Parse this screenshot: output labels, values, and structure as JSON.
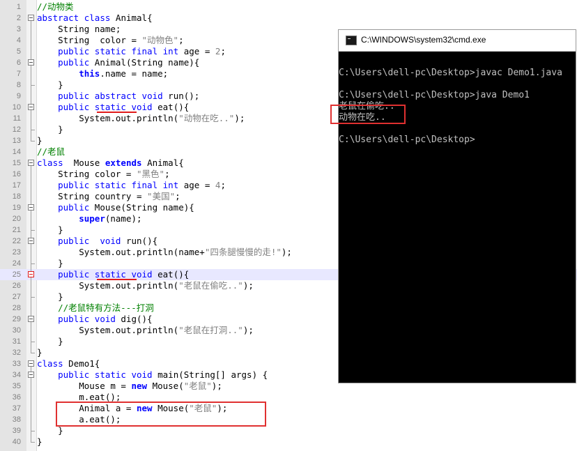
{
  "editor": {
    "lines": [
      {
        "n": "1",
        "tokens": [
          [
            "c",
            "//动物类"
          ]
        ]
      },
      {
        "n": "2",
        "tokens": [
          [
            "k",
            "abstract"
          ],
          [
            "p",
            " "
          ],
          [
            "k",
            "class"
          ],
          [
            "p",
            " Animal{"
          ]
        ]
      },
      {
        "n": "3",
        "tokens": [
          [
            "p",
            "    String name;"
          ]
        ]
      },
      {
        "n": "4",
        "tokens": [
          [
            "p",
            "    String  color = "
          ],
          [
            "s",
            "\"动物色\""
          ],
          [
            "p",
            ";"
          ]
        ]
      },
      {
        "n": "5",
        "tokens": [
          [
            "k",
            "    public"
          ],
          [
            "p",
            " "
          ],
          [
            "k",
            "static"
          ],
          [
            "p",
            " "
          ],
          [
            "k",
            "final"
          ],
          [
            "p",
            " "
          ],
          [
            "k",
            "int"
          ],
          [
            "p",
            " age = "
          ],
          [
            "s",
            "2"
          ],
          [
            "p",
            ";"
          ]
        ]
      },
      {
        "n": "6",
        "tokens": [
          [
            "k",
            "    public"
          ],
          [
            "p",
            " Animal(String name){"
          ]
        ]
      },
      {
        "n": "7",
        "tokens": [
          [
            "p",
            "        "
          ],
          [
            "b",
            "this"
          ],
          [
            "p",
            ".name = name;"
          ]
        ]
      },
      {
        "n": "8",
        "tokens": [
          [
            "p",
            "    }"
          ]
        ]
      },
      {
        "n": "9",
        "tokens": [
          [
            "k",
            "    public"
          ],
          [
            "p",
            " "
          ],
          [
            "k",
            "abstract"
          ],
          [
            "p",
            " "
          ],
          [
            "k",
            "void"
          ],
          [
            "p",
            " run();"
          ]
        ]
      },
      {
        "n": "10",
        "tokens": [
          [
            "k",
            "    public"
          ],
          [
            "p",
            " "
          ],
          [
            "k",
            "static"
          ],
          [
            "p",
            " "
          ],
          [
            "k",
            "void"
          ],
          [
            "p",
            " eat(){"
          ]
        ]
      },
      {
        "n": "11",
        "tokens": [
          [
            "p",
            "        System.out.println("
          ],
          [
            "s",
            "\"动物在吃..\""
          ],
          [
            "p",
            ");"
          ]
        ]
      },
      {
        "n": "12",
        "tokens": [
          [
            "p",
            "    }"
          ]
        ]
      },
      {
        "n": "13",
        "tokens": [
          [
            "p",
            "}"
          ]
        ]
      },
      {
        "n": "14",
        "tokens": [
          [
            "c",
            "//老鼠"
          ]
        ]
      },
      {
        "n": "15",
        "tokens": [
          [
            "k",
            "class"
          ],
          [
            "p",
            "  Mouse "
          ],
          [
            "b",
            "extends"
          ],
          [
            "p",
            " Animal{"
          ]
        ]
      },
      {
        "n": "16",
        "tokens": [
          [
            "p",
            "    String color = "
          ],
          [
            "s",
            "\"黑色\""
          ],
          [
            "p",
            ";"
          ]
        ]
      },
      {
        "n": "17",
        "tokens": [
          [
            "k",
            "    public"
          ],
          [
            "p",
            " "
          ],
          [
            "k",
            "static"
          ],
          [
            "p",
            " "
          ],
          [
            "k",
            "final"
          ],
          [
            "p",
            " "
          ],
          [
            "k",
            "int"
          ],
          [
            "p",
            " age = "
          ],
          [
            "s",
            "4"
          ],
          [
            "p",
            ";"
          ]
        ]
      },
      {
        "n": "18",
        "tokens": [
          [
            "p",
            "    String country = "
          ],
          [
            "s",
            "\"美国\""
          ],
          [
            "p",
            ";"
          ]
        ]
      },
      {
        "n": "19",
        "tokens": [
          [
            "k",
            "    public"
          ],
          [
            "p",
            " Mouse(String name){"
          ]
        ]
      },
      {
        "n": "20",
        "tokens": [
          [
            "p",
            "        "
          ],
          [
            "b",
            "super"
          ],
          [
            "p",
            "(name);"
          ]
        ]
      },
      {
        "n": "21",
        "tokens": [
          [
            "p",
            "    }"
          ]
        ]
      },
      {
        "n": "22",
        "tokens": [
          [
            "k",
            "    public"
          ],
          [
            "p",
            "  "
          ],
          [
            "k",
            "void"
          ],
          [
            "p",
            " run(){"
          ]
        ]
      },
      {
        "n": "23",
        "tokens": [
          [
            "p",
            "        System.out.println(name+"
          ],
          [
            "s",
            "\"四条腿慢慢的走!\""
          ],
          [
            "p",
            ");"
          ]
        ]
      },
      {
        "n": "24",
        "tokens": [
          [
            "p",
            "    }"
          ]
        ]
      },
      {
        "n": "25",
        "tokens": [
          [
            "k",
            "    public"
          ],
          [
            "p",
            " "
          ],
          [
            "k",
            "static"
          ],
          [
            "p",
            " "
          ],
          [
            "k",
            "void"
          ],
          [
            "p",
            " eat(){"
          ]
        ]
      },
      {
        "n": "26",
        "tokens": [
          [
            "p",
            "        System.out.println("
          ],
          [
            "s",
            "\"老鼠在偷吃..\""
          ],
          [
            "p",
            ");"
          ]
        ]
      },
      {
        "n": "27",
        "tokens": [
          [
            "p",
            "    }"
          ]
        ]
      },
      {
        "n": "28",
        "tokens": [
          [
            "c",
            "    //老鼠特有方法---打洞"
          ]
        ]
      },
      {
        "n": "29",
        "tokens": [
          [
            "k",
            "    public"
          ],
          [
            "p",
            " "
          ],
          [
            "k",
            "void"
          ],
          [
            "p",
            " dig(){"
          ]
        ]
      },
      {
        "n": "30",
        "tokens": [
          [
            "p",
            "        System.out.println("
          ],
          [
            "s",
            "\"老鼠在打洞..\""
          ],
          [
            "p",
            ");"
          ]
        ]
      },
      {
        "n": "31",
        "tokens": [
          [
            "p",
            "    }"
          ]
        ]
      },
      {
        "n": "32",
        "tokens": [
          [
            "p",
            "}"
          ]
        ]
      },
      {
        "n": "33",
        "tokens": [
          [
            "k",
            "class"
          ],
          [
            "p",
            " Demo1{"
          ]
        ]
      },
      {
        "n": "34",
        "tokens": [
          [
            "k",
            "    public"
          ],
          [
            "p",
            " "
          ],
          [
            "k",
            "static"
          ],
          [
            "p",
            " "
          ],
          [
            "k",
            "void"
          ],
          [
            "p",
            " main(String[] args) {"
          ]
        ]
      },
      {
        "n": "35",
        "tokens": [
          [
            "p",
            "        Mouse m = "
          ],
          [
            "b",
            "new"
          ],
          [
            "p",
            " Mouse("
          ],
          [
            "s",
            "\"老鼠\""
          ],
          [
            "p",
            ");"
          ]
        ]
      },
      {
        "n": "36",
        "tokens": [
          [
            "p",
            "        m.eat();"
          ]
        ]
      },
      {
        "n": "37",
        "tokens": [
          [
            "p",
            "        Animal a = "
          ],
          [
            "b",
            "new"
          ],
          [
            "p",
            " Mouse("
          ],
          [
            "s",
            "\"老鼠\""
          ],
          [
            "p",
            ");"
          ]
        ]
      },
      {
        "n": "38",
        "tokens": [
          [
            "p",
            "        a.eat();"
          ]
        ]
      },
      {
        "n": "39",
        "tokens": [
          [
            "p",
            "    }"
          ]
        ]
      },
      {
        "n": "40",
        "tokens": [
          [
            "p",
            "}"
          ]
        ]
      }
    ],
    "highlighted_line": "25"
  },
  "cmd": {
    "title": "C:\\WINDOWS\\system32\\cmd.exe",
    "lines": [
      "",
      "C:\\Users\\dell-pc\\Desktop>javac Demo1.java",
      "",
      "C:\\Users\\dell-pc\\Desktop>java Demo1",
      "老鼠在偷吃..",
      "动物在吃..",
      "",
      "C:\\Users\\dell-pc\\Desktop>"
    ]
  }
}
